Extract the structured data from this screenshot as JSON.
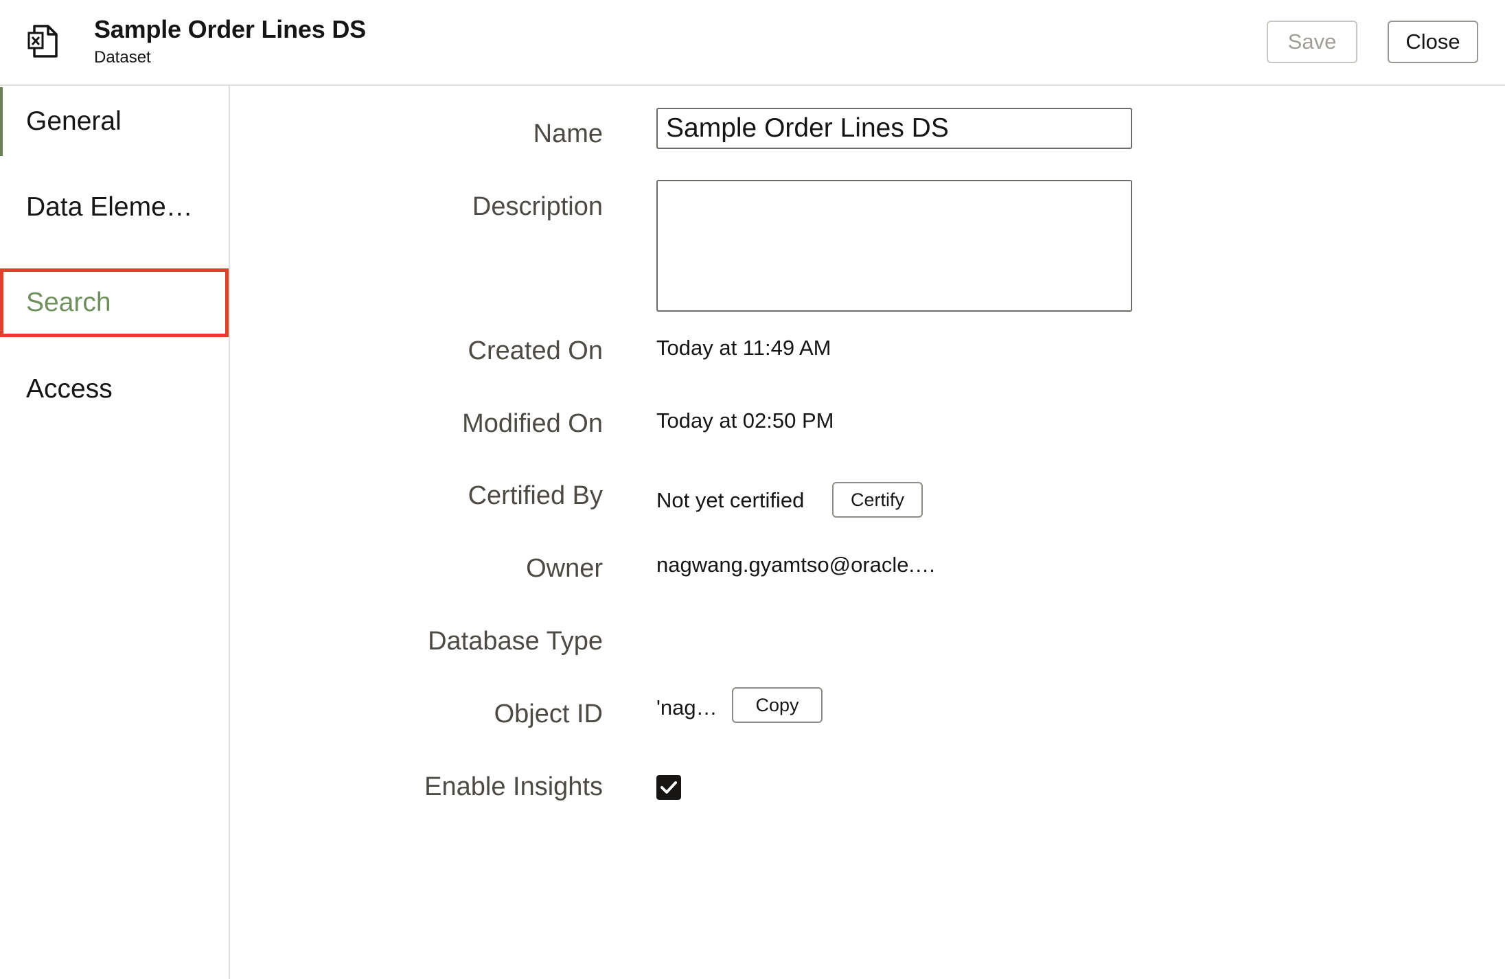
{
  "header": {
    "title": "Sample Order Lines DS",
    "subtitle": "Dataset",
    "save_label": "Save",
    "close_label": "Close",
    "icon": "excel-document-icon"
  },
  "sidebar": {
    "items": [
      {
        "label": "General"
      },
      {
        "label": "Data Eleme…"
      },
      {
        "label": "Search"
      },
      {
        "label": "Access"
      }
    ]
  },
  "form": {
    "name_label": "Name",
    "name_value": "Sample Order Lines DS",
    "description_label": "Description",
    "description_value": "",
    "created_on_label": "Created On",
    "created_on_value": "Today at 11:49 AM",
    "modified_on_label": "Modified On",
    "modified_on_value": "Today at 02:50 PM",
    "certified_by_label": "Certified By",
    "certified_by_value": "Not yet certified",
    "certify_label": "Certify",
    "owner_label": "Owner",
    "owner_value": "nagwang.gyamtso@oracle.…",
    "database_type_label": "Database Type",
    "database_type_value": "",
    "object_id_label": "Object ID",
    "object_id_value": "'nag…",
    "copy_label": "Copy",
    "enable_insights_label": "Enable Insights",
    "enable_insights_checked": true
  },
  "colors": {
    "selected_nav_text": "#6f8f5f",
    "highlight_border": "#e0402b",
    "active_bar": "#6b7f5a"
  }
}
